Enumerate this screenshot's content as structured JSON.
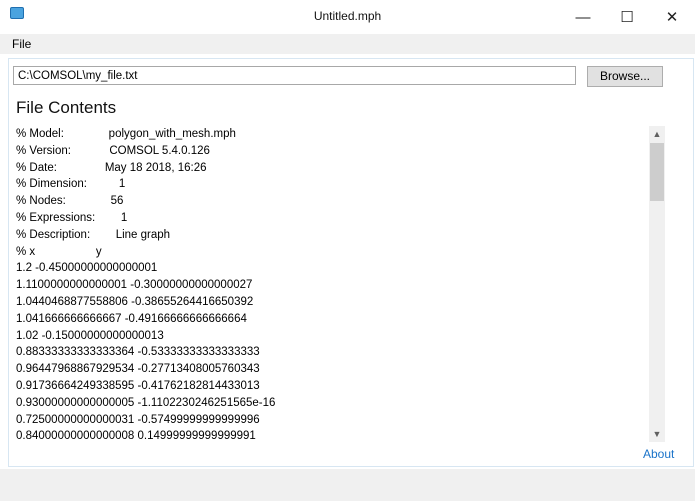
{
  "window": {
    "title": "Untitled.mph",
    "minimize_glyph": "—",
    "maximize_glyph": "☐",
    "close_glyph": "✕"
  },
  "menu": {
    "file": "File"
  },
  "path": {
    "value": "C:\\COMSOL\\my_file.txt"
  },
  "browse": {
    "label": "Browse..."
  },
  "contents": {
    "heading": "File Contents",
    "lines": [
      "% Model:              polygon_with_mesh.mph",
      "% Version:            COMSOL 5.4.0.126",
      "% Date:               May 18 2018, 16:26",
      "% Dimension:          1",
      "% Nodes:              56",
      "% Expressions:        1",
      "% Description:        Line graph",
      "% x                   y",
      "1.2 -0.45000000000000001",
      "1.1100000000000001 -0.30000000000000027",
      "1.0440468877558806 -0.38655264416650392",
      "1.041666666666667 -0.49166666666666664",
      "1.02 -0.15000000000000013",
      "0.88333333333333364 -0.53333333333333333",
      "0.96447968867929534 -0.27713408005760343",
      "0.91736664249338595 -0.41762182814433013",
      "0.93000000000000005 -1.1102230246251565e-16",
      "0.72500000000000031 -0.57499999999999996",
      "0.84000000000000008 0.14999999999999991"
    ]
  },
  "scroll": {
    "up": "▲",
    "down": "▼"
  },
  "about": {
    "label": "About"
  }
}
